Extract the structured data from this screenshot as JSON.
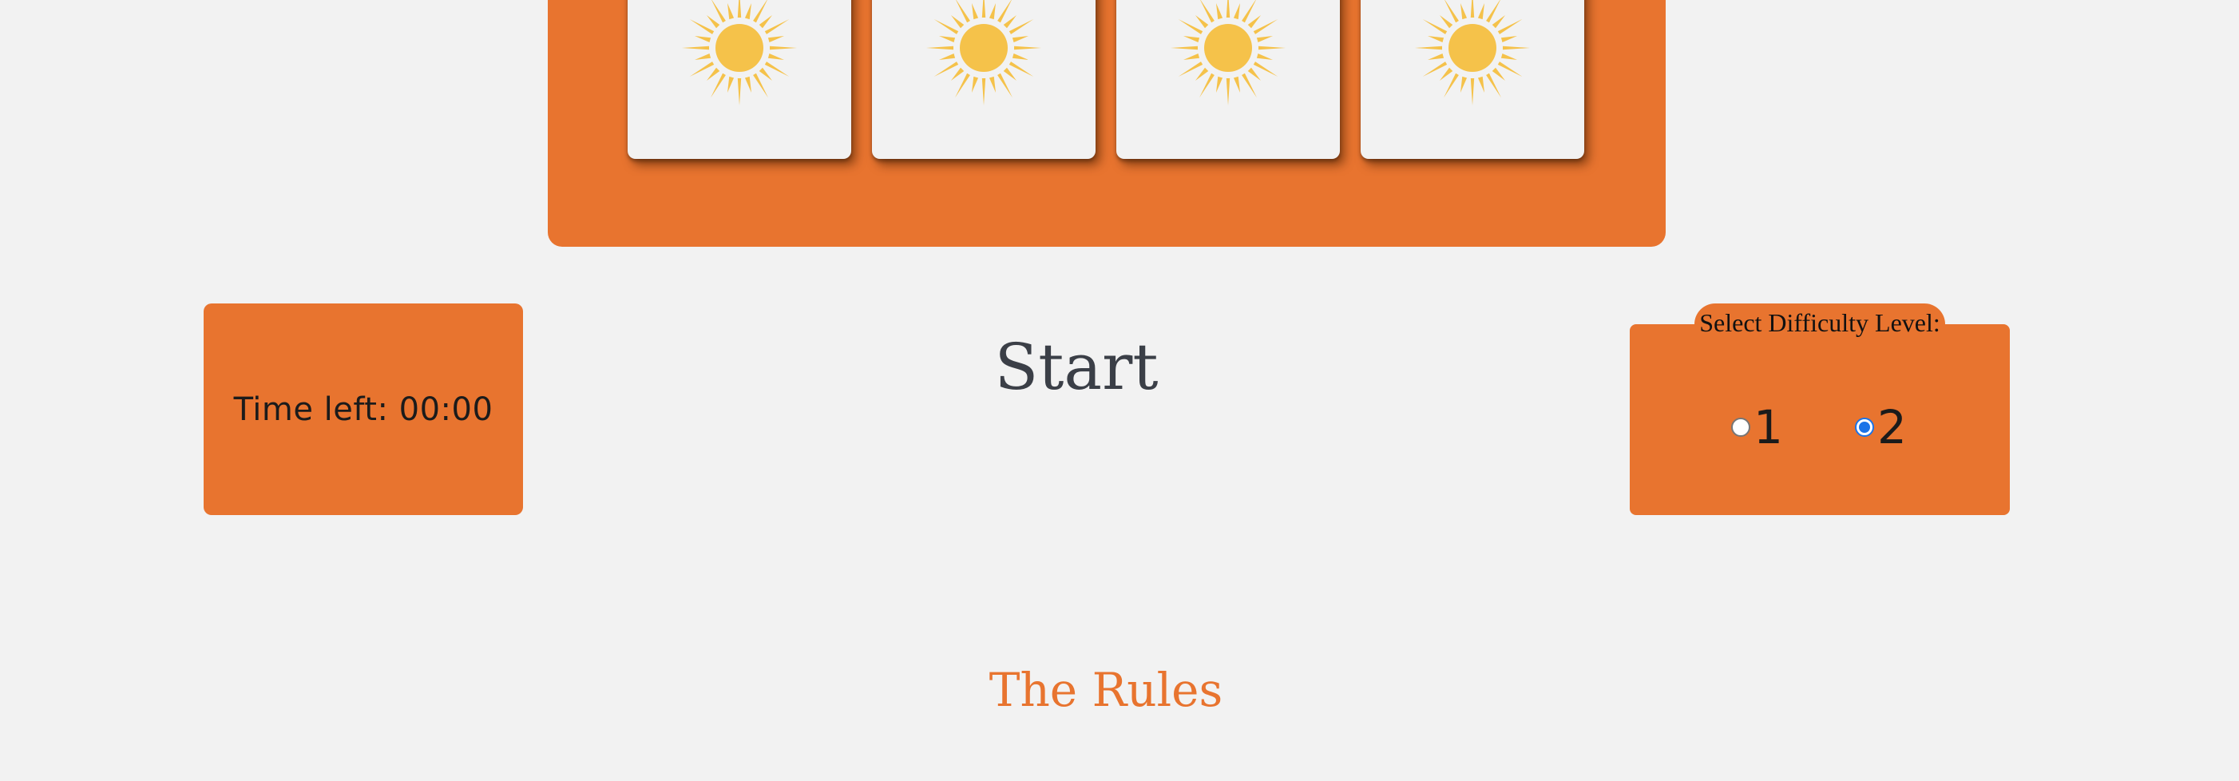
{
  "board": {
    "cards": [
      {
        "face": "sun-icon"
      },
      {
        "face": "sun-icon"
      },
      {
        "face": "sun-icon"
      },
      {
        "face": "sun-icon"
      }
    ]
  },
  "timer": {
    "text": "Time left: 00:00"
  },
  "start": {
    "label": "Start"
  },
  "difficulty": {
    "legend": "Select Difficulty Level:",
    "options": [
      {
        "label": "1",
        "checked": false
      },
      {
        "label": "2",
        "checked": true
      }
    ]
  },
  "rules": {
    "title": "The Rules"
  },
  "colors": {
    "accent": "#e8742f",
    "background": "#f2f2f2",
    "sun": "#f5c24a",
    "radio_checked": "#1a73e8"
  }
}
